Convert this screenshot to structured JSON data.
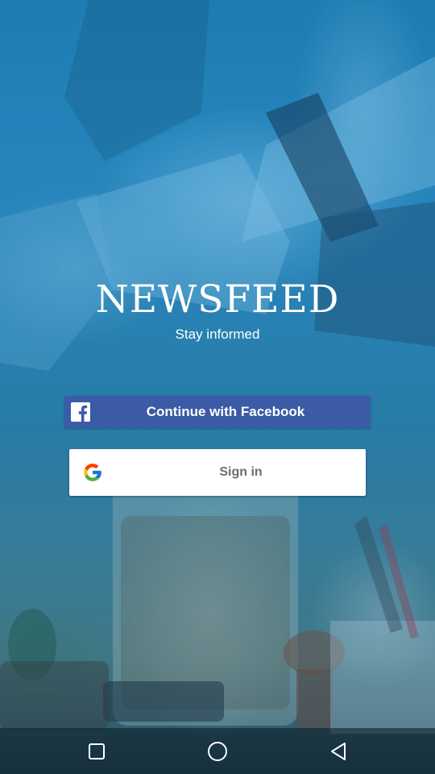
{
  "app": {
    "title": "NEWSFEED",
    "tagline": "Stay informed"
  },
  "auth": {
    "facebook": {
      "label": "Continue with Facebook",
      "icon": "facebook-icon",
      "color": "#3b5ba6"
    },
    "google": {
      "label": "Sign in",
      "icon": "google-icon",
      "color": "#ffffff",
      "text_color": "#6d6d6d"
    }
  },
  "navbar": {
    "buttons": [
      "recents-square-icon",
      "home-circle-icon",
      "back-triangle-icon"
    ]
  }
}
